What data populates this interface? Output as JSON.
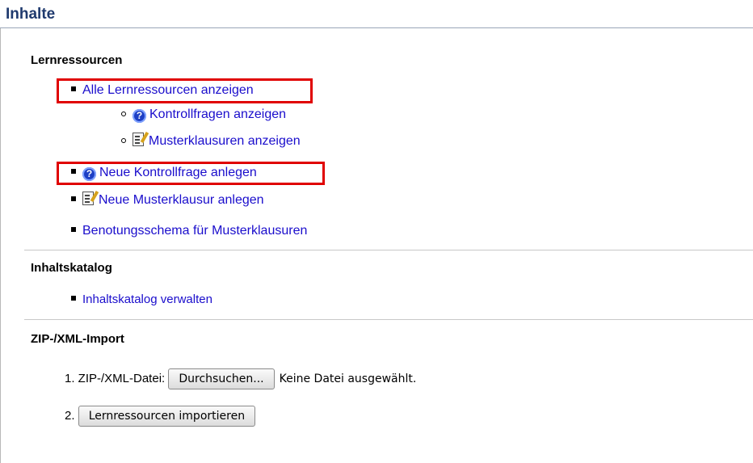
{
  "page_title": "Inhalte",
  "sections": {
    "lernressourcen": {
      "title": "Lernressourcen",
      "items": {
        "alle": "Alle Lernressourcen anzeigen",
        "kontrollfragen": "Kontrollfragen anzeigen",
        "musterklausuren": "Musterklausuren anzeigen",
        "neue_kontrollfrage": "Neue Kontrollfrage anlegen",
        "neue_musterklausur": "Neue Musterklausur anlegen",
        "benotungsschema": "Benotungsschema für Musterklausuren"
      }
    },
    "inhaltskatalog": {
      "title": "Inhaltskatalog",
      "items": {
        "verwalten": "Inhaltskatalog verwalten"
      }
    },
    "import": {
      "title": "ZIP-/XML-Import",
      "step1_label": "1. ZIP-/XML-Datei:",
      "browse_button": "Durchsuchen...",
      "file_status": "Keine Datei ausgewählt.",
      "step2_label": "2.",
      "import_button": "Lernressourcen importieren"
    }
  },
  "icons": {
    "question": "question-icon",
    "document": "document-icon"
  },
  "colors": {
    "link": "#1a0dcc",
    "title": "#1f3a6e",
    "highlight": "#e00000"
  }
}
